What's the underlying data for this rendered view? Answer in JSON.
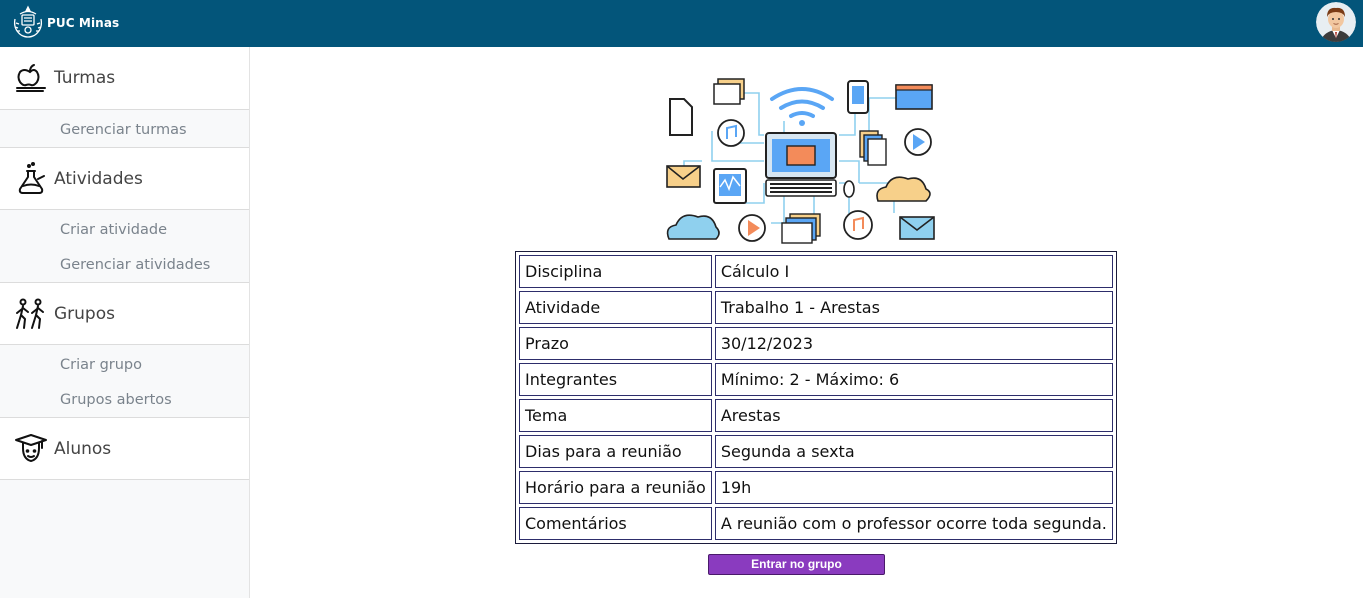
{
  "header": {
    "brand": "PUC Minas",
    "brand_logo": "puc-minas-crest-icon",
    "avatar": "user-avatar",
    "colors": {
      "bar": "#03557a"
    }
  },
  "sidebar": {
    "sections": [
      {
        "label": "Turmas",
        "icon": "apple-book-icon",
        "items": [
          "Gerenciar turmas"
        ]
      },
      {
        "label": "Atividades",
        "icon": "flask-icon",
        "items": [
          "Criar atividade",
          "Gerenciar atividades"
        ]
      },
      {
        "label": "Grupos",
        "icon": "people-walking-icon",
        "items": [
          "Criar grupo",
          "Grupos abertos"
        ]
      },
      {
        "label": "Alunos",
        "icon": "graduate-icon",
        "items": []
      }
    ]
  },
  "main": {
    "illustration": "network-devices-illustration",
    "details": [
      {
        "label": "Disciplina",
        "value": "Cálculo I"
      },
      {
        "label": "Atividade",
        "value": "Trabalho 1 - Arestas"
      },
      {
        "label": "Prazo",
        "value": "30/12/2023"
      },
      {
        "label": "Integrantes",
        "value": "Mínimo: 2 - Máximo: 6"
      },
      {
        "label": "Tema",
        "value": "Arestas"
      },
      {
        "label": "Dias para a reunião",
        "value": "Segunda a sexta"
      },
      {
        "label": "Horário para a reunião",
        "value": "19h"
      },
      {
        "label": "Comentários",
        "value": "A reunião com o professor ocorre toda segunda."
      }
    ],
    "join_button": "Entrar no grupo",
    "colors": {
      "button": "#8a3bbf"
    }
  }
}
